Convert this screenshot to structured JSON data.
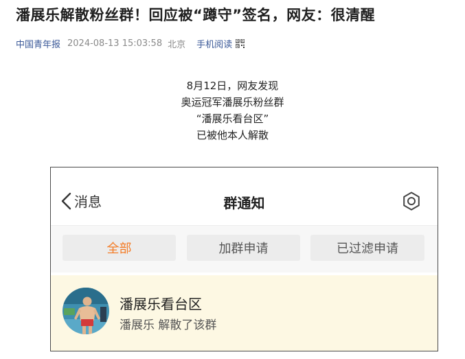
{
  "article": {
    "headline": "潘展乐解散粉丝群！回应被“蹲守”签名，网友：很清醒",
    "source": "中国青年报",
    "datetime": "2024-08-13 15:03:58",
    "location": "北京",
    "mobile_read": "手机阅读",
    "caption_lines": [
      "8月12日，网友发现",
      "奥运冠军潘展乐粉丝群",
      "“潘展乐看台区”",
      "已被他本人解散"
    ]
  },
  "screenshot": {
    "back_label": "消息",
    "title": "群通知",
    "tabs": [
      "全部",
      "加群申请",
      "已过滤申请"
    ],
    "active_tab": 0,
    "notice": {
      "group_name": "潘展乐看台区",
      "text": "潘展乐 解散了该群"
    },
    "colors": {
      "accent": "#f47b25",
      "notice_bg": "#fdf8e3",
      "link": "#3b5998"
    }
  }
}
